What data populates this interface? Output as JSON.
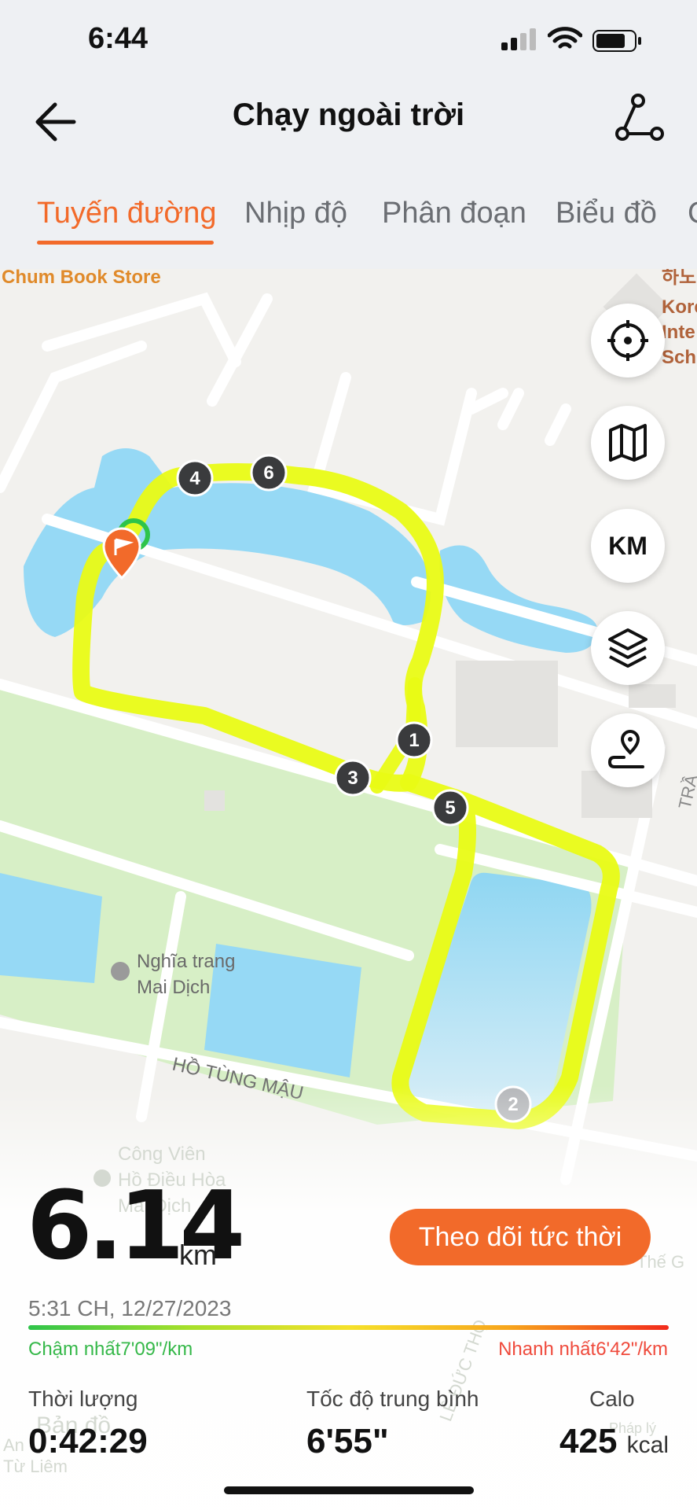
{
  "status": {
    "time": "6:44"
  },
  "header": {
    "title": "Chạy ngoài trời"
  },
  "tabs": [
    "Tuyến đường",
    "Nhịp độ",
    "Phân đoạn",
    "Biểu đồ",
    "C"
  ],
  "map": {
    "place_labels": [
      "Chum Book Store",
      "하노",
      "Kore",
      "Inte",
      "Sch",
      "Nghĩa trang",
      "Mai Dịch",
      "HỒ TÙNG MẬU",
      "Công Viên",
      "Hồ Điều Hòa",
      "Mai Dịch",
      "TRẦ",
      "LÊ ĐỨC THỌ",
      "Thế G",
      "Bản đồ",
      "Pháp lý",
      "An",
      "Từ Liêm"
    ],
    "markers": [
      "1",
      "2",
      "3",
      "4",
      "5",
      "6"
    ],
    "unit_button": "KM",
    "route_color": "#e9fb15"
  },
  "summary": {
    "distance": "6.14",
    "distance_unit": "km",
    "live_button": "Theo dõi tức thời",
    "datetime": "5:31 CH, 12/27/2023",
    "slowest": "Chậm nhất7'09\"/km",
    "fastest": "Nhanh nhất6'42\"/km"
  },
  "stats": {
    "duration_label": "Thời lượng",
    "duration_value": "0:42:29",
    "pace_label": "Tốc độ trung bình",
    "pace_value": "6'55\"",
    "calorie_label": "Calo",
    "calorie_value": "425",
    "calorie_unit": "kcal"
  },
  "colors": {
    "accent": "#f26a2a",
    "slow": "#35b849",
    "fast": "#ef4a3c"
  }
}
